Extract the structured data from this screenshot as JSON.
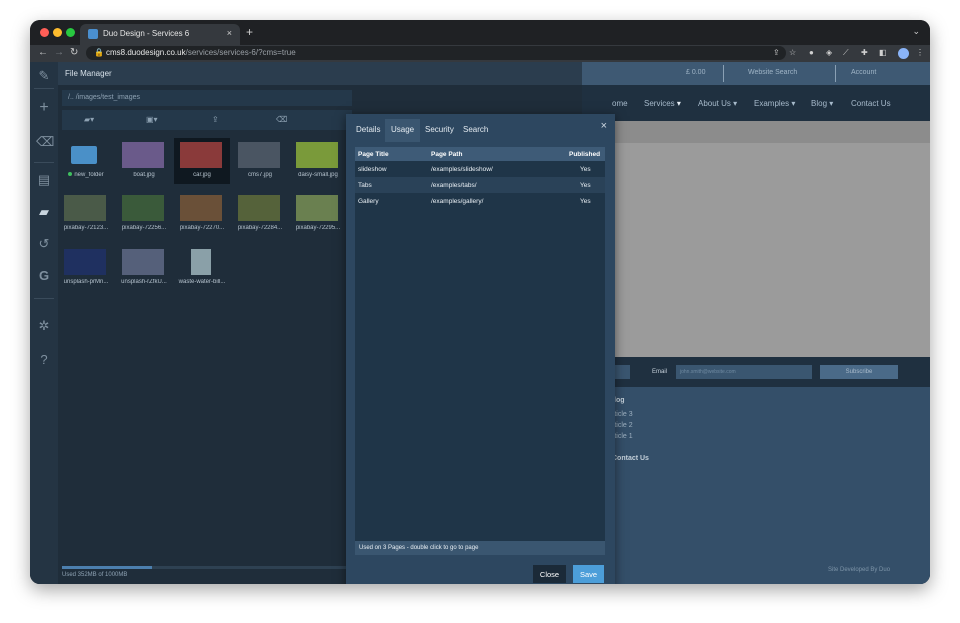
{
  "browser": {
    "tab_title": "Duo Design - Services 6",
    "tab_close": "×",
    "new_tab": "+",
    "url_host": "cms8.duodesign.co.uk",
    "url_path": "/services/services-6/?cms=true"
  },
  "file_manager": {
    "title": "File Manager",
    "path": "/.. /images/test_images",
    "usage_text": "Used 352MB of 1000MB",
    "usage_fraction": 0.352,
    "items": [
      {
        "label": "new_folder",
        "type": "folder",
        "color": "#4a90c8"
      },
      {
        "label": "boat.jpg",
        "type": "image",
        "color": "#6a5a8a"
      },
      {
        "label": "car.jpg",
        "type": "image",
        "color": "#8a3a3a",
        "selected": true
      },
      {
        "label": "cms7.jpg",
        "type": "image",
        "color": "#4a5562"
      },
      {
        "label": "daisy-small.jpg",
        "type": "image",
        "color": "#7a9a3a"
      },
      {
        "label": "pixabay-72123...",
        "type": "image",
        "color": "#4a5a48"
      },
      {
        "label": "pixabay-72256...",
        "type": "image",
        "color": "#3a5a3a"
      },
      {
        "label": "pixabay-72270...",
        "type": "image",
        "color": "#6a5038"
      },
      {
        "label": "pixabay-72284...",
        "type": "image",
        "color": "#55623a"
      },
      {
        "label": "pixabay-72295...",
        "type": "image",
        "color": "#6a8050"
      },
      {
        "label": "unsplash-prMn...",
        "type": "image",
        "color": "#1f3060"
      },
      {
        "label": "unsplash-rZfkU...",
        "type": "image",
        "color": "#55607a"
      },
      {
        "label": "waste-water-bill...",
        "type": "image",
        "color": "#8aa0a8"
      }
    ]
  },
  "modal": {
    "tabs": [
      "Details",
      "Usage",
      "Security",
      "Search"
    ],
    "active_tab": "Usage",
    "close": "×",
    "columns": [
      "Page Title",
      "Page Path",
      "Published"
    ],
    "rows": [
      {
        "title": "slideshow",
        "path": "/examples/slideshow/",
        "published": "Yes"
      },
      {
        "title": "Tabs",
        "path": "/examples/tabs/",
        "published": "Yes"
      },
      {
        "title": "Gallery",
        "path": "/examples/gallery/",
        "published": "Yes"
      }
    ],
    "footer_text": "Used on 3 Pages - double click to go to page",
    "close_label": "Close",
    "save_label": "Save"
  },
  "site": {
    "price": "£ 0.00",
    "search": "Website Search",
    "account": "Account",
    "nav": [
      "ome",
      "Services",
      "About Us",
      "Examples",
      "Blog",
      "Contact Us"
    ],
    "email_label": "Email",
    "email_placeholder": "john.smith@website.com",
    "subscribe": "Subscribe",
    "blog_heading": "log",
    "articles": [
      "rticle 3",
      "rticle 2",
      "rticle 1"
    ],
    "contact_heading": "Contact Us",
    "credit": "Site Developed By Duo"
  }
}
